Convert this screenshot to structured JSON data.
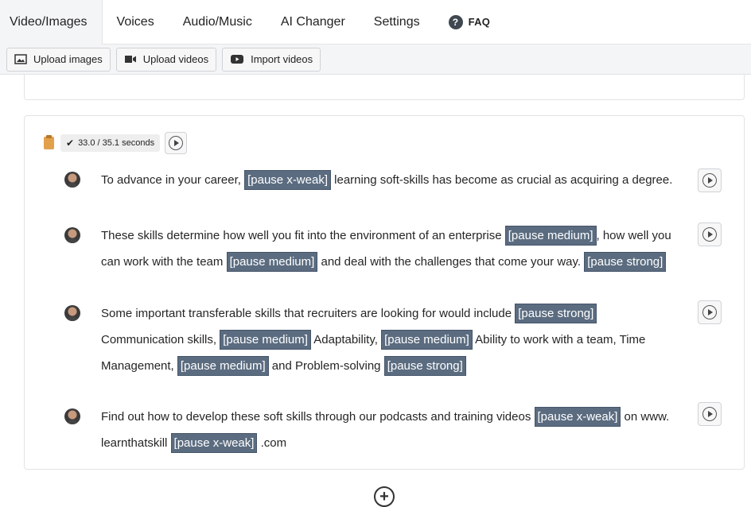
{
  "tabs": [
    {
      "label": "Video/Images"
    },
    {
      "label": "Voices"
    },
    {
      "label": "Audio/Music"
    },
    {
      "label": "AI Changer"
    },
    {
      "label": "Settings"
    },
    {
      "label": "FAQ"
    }
  ],
  "faq_icon_glyph": "?",
  "toolbar": {
    "upload_images": "Upload images",
    "upload_videos": "Upload videos",
    "import_videos": "Import videos"
  },
  "scene": {
    "duration": "33.0 / 35.1 seconds",
    "check_glyph": "✔",
    "lines": [
      {
        "parts": [
          {
            "text": "To advance in your career, "
          },
          {
            "pause": "[pause x-weak]"
          },
          {
            "text": " learning soft-skills has become as crucial as acquiring a degree."
          }
        ]
      },
      {
        "parts": [
          {
            "text": "These skills determine how well you fit into the environment of an enterprise "
          },
          {
            "pause": "[pause medium]"
          },
          {
            "text": ", how well you can work with the team "
          },
          {
            "pause": "[pause medium]"
          },
          {
            "text": " and deal with the challenges that come your way. "
          },
          {
            "pause": "[pause strong]"
          }
        ]
      },
      {
        "parts": [
          {
            "text": "Some important transferable skills that recruiters are looking for would include "
          },
          {
            "pause": "[pause strong]"
          },
          {
            "text": " Communication skills, "
          },
          {
            "pause": "[pause medium]"
          },
          {
            "text": " Adaptability, "
          },
          {
            "pause": "[pause medium]"
          },
          {
            "text": " Ability to work with a team, Time Management, "
          },
          {
            "pause": "[pause medium]"
          },
          {
            "text": " and Problem-solving "
          },
          {
            "pause": "[pause strong]"
          }
        ]
      },
      {
        "parts": [
          {
            "text": "Find out how to develop these soft skills through our podcasts and training videos "
          },
          {
            "pause": "[pause x-weak]"
          },
          {
            "text": " on www. learnthatskill "
          },
          {
            "pause": "[pause x-weak]"
          },
          {
            "text": " .com"
          }
        ]
      }
    ]
  },
  "add_glyph": "+",
  "colors": {
    "pause_tag_bg": "#5b6c80",
    "active_tab_bg": "#f4f5f7"
  }
}
